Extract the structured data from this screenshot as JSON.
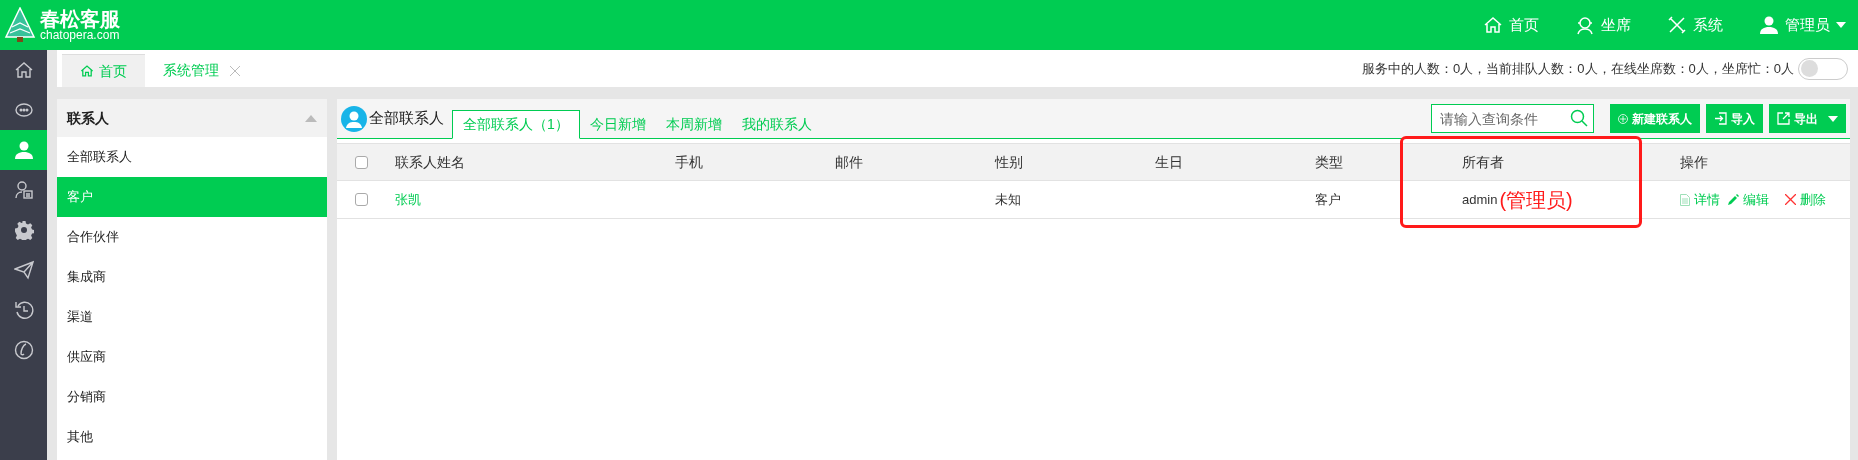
{
  "header": {
    "logo_title": "春松客服",
    "logo_subtitle": "chatopera.com",
    "nav": [
      {
        "label": "首页",
        "dropdown": false
      },
      {
        "label": "坐席",
        "dropdown": false
      },
      {
        "label": "系统",
        "dropdown": false
      },
      {
        "label": "管理员",
        "dropdown": true
      }
    ]
  },
  "rail": [
    {
      "selected": false
    },
    {
      "selected": false
    },
    {
      "selected": true
    },
    {
      "selected": false
    },
    {
      "selected": false
    },
    {
      "selected": false
    },
    {
      "selected": false
    },
    {
      "selected": false
    }
  ],
  "tabs": [
    {
      "label": "首页",
      "selected": true,
      "closable": false
    },
    {
      "label": "系统管理",
      "selected": false,
      "closable": true
    }
  ],
  "status": {
    "text": "服务中的人数：0人，当前排队人数：0人，在线坐席数：0人，坐席忙：0人",
    "toggle_on": false
  },
  "sidebar": {
    "title": "联系人",
    "expanded": true,
    "items": [
      {
        "label": "全部联系人",
        "selected": false
      },
      {
        "label": "客户",
        "selected": true
      },
      {
        "label": "合作伙伴",
        "selected": false
      },
      {
        "label": "集成商",
        "selected": false
      },
      {
        "label": "渠道",
        "selected": false
      },
      {
        "label": "供应商",
        "selected": false
      },
      {
        "label": "分销商",
        "selected": false
      },
      {
        "label": "其他",
        "selected": false
      }
    ]
  },
  "content": {
    "heading": "全部联系人",
    "tabs": [
      {
        "label": "全部联系人（1）",
        "selected": true
      },
      {
        "label": "今日新增",
        "selected": false
      },
      {
        "label": "本周新增",
        "selected": false
      },
      {
        "label": "我的联系人",
        "selected": false
      }
    ],
    "search": {
      "placeholder": "请输入查询条件"
    },
    "buttons": [
      {
        "label": "新建联系人",
        "kind": "new"
      },
      {
        "label": "导入",
        "kind": "import"
      },
      {
        "label": "导出",
        "kind": "export"
      }
    ],
    "table": {
      "header_checked": false,
      "columns": [
        "联系人姓名",
        "手机",
        "邮件",
        "性别",
        "生日",
        "类型",
        "所有者",
        "操作"
      ],
      "rows": [
        {
          "checked": false,
          "name": "张凯",
          "phone": "",
          "email": "",
          "gender": "未知",
          "birthday": "",
          "type": "客户",
          "owner": "admin",
          "actions": [
            "详情",
            "编辑",
            "删除"
          ]
        }
      ]
    },
    "annotation": {
      "text": "(管理员)"
    }
  }
}
